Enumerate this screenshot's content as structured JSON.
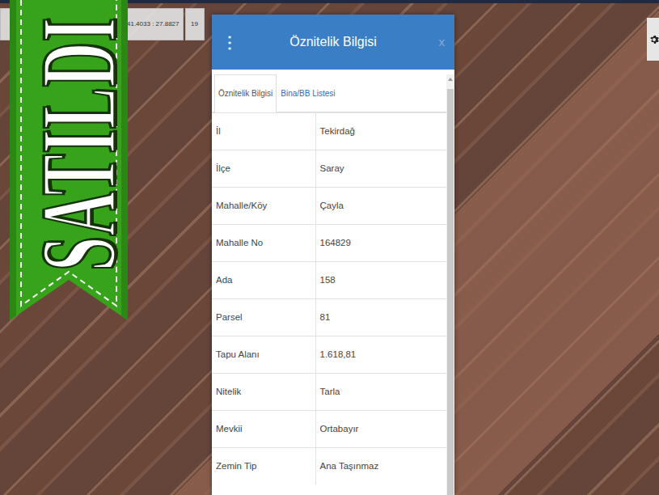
{
  "ribbon": {
    "text": "SATILDI"
  },
  "toolbar": {
    "coordinates": "41.4033 : 27.8827",
    "zoom": "19"
  },
  "dialog": {
    "menu": "⋮",
    "title": "Öznitelik Bilgisi",
    "close": "x",
    "tabs": [
      {
        "label": "Öznitelik Bilgisi",
        "selected": true
      },
      {
        "label": "Bina/BB Listesi",
        "selected": false
      }
    ],
    "rows": [
      [
        "İl",
        "Tekirdağ"
      ],
      [
        "İlçe",
        "Saray"
      ],
      [
        "Mahalle/Köy",
        "Çayla"
      ],
      [
        "Mahalle No",
        "164829"
      ],
      [
        "Ada",
        "158"
      ],
      [
        "Parsel",
        "81"
      ],
      [
        "Tapu Alanı",
        "1.618,81"
      ],
      [
        "Nitelik",
        "Tarla"
      ],
      [
        "Mevkii",
        "Ortabayır"
      ],
      [
        "Zemin Tip",
        "Ana Taşınmaz"
      ]
    ]
  }
}
